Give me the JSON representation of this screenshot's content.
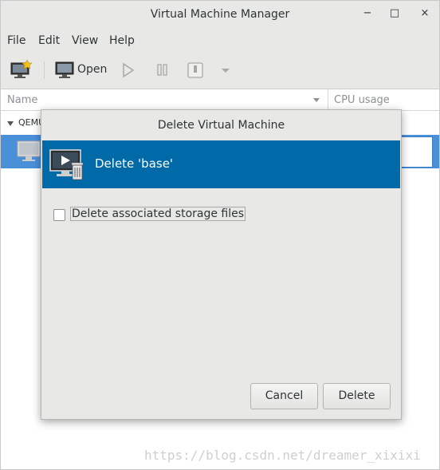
{
  "window": {
    "title": "Virtual Machine Manager",
    "minimize_glyph": "−",
    "maximize_glyph": "□",
    "close_glyph": "×"
  },
  "menubar": {
    "items": [
      "File",
      "Edit",
      "View",
      "Help"
    ]
  },
  "toolbar": {
    "open_label": "Open",
    "icons": [
      "new-vm-icon",
      "open-monitor-icon",
      "run-icon",
      "pause-icon",
      "shutdown-icon",
      "shutdown-dropdown-icon"
    ]
  },
  "list": {
    "col_name": "Name",
    "col_cpu": "CPU usage",
    "group_label": "QEMU"
  },
  "dialog": {
    "title": "Delete Virtual Machine",
    "header_text": "Delete 'base'",
    "checkbox_label": "Delete associated storage files",
    "checkbox_checked": false,
    "cancel_label": "Cancel",
    "delete_label": "Delete",
    "header_color": "#0069a8"
  },
  "watermark": "https://blog.csdn.net/dreamer_xixixi",
  "selection_color": "#4a90d9"
}
